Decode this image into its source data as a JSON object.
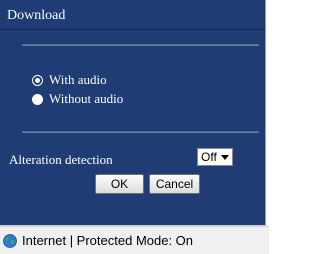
{
  "dialog": {
    "title": "Download",
    "options": [
      {
        "label": "With audio",
        "selected": true
      },
      {
        "label": "Without audio",
        "selected": false
      }
    ],
    "alteration_label": "Alteration detection",
    "alteration_value": "Off",
    "ok_label": "OK",
    "cancel_label": "Cancel"
  },
  "statusbar": {
    "text": "Internet | Protected Mode: On",
    "icon": "globe-icon"
  },
  "colors": {
    "panel_bg": "#1f3c74",
    "text": "#ffffff"
  }
}
